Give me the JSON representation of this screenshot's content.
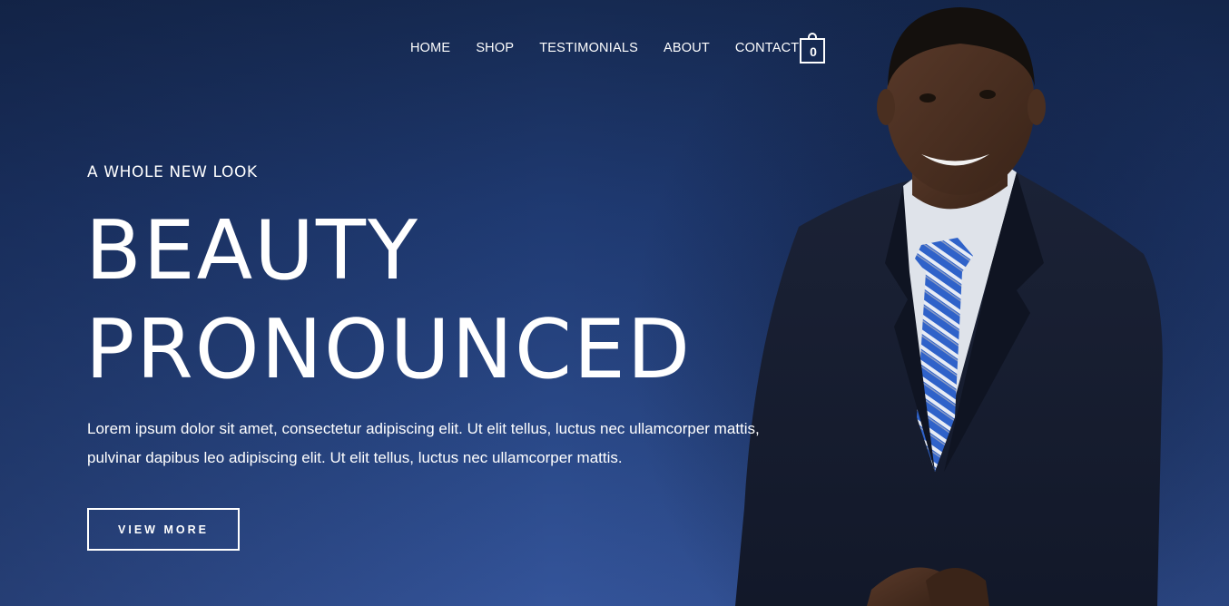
{
  "nav": {
    "items": [
      {
        "label": "HOME"
      },
      {
        "label": "SHOP"
      },
      {
        "label": "TESTIMONIALS"
      },
      {
        "label": "ABOUT"
      },
      {
        "label": "CONTACT"
      }
    ],
    "cart_count": "0"
  },
  "hero": {
    "eyebrow": "A WHOLE NEW LOOK",
    "headline_line1": "BEAUTY",
    "headline_line2": "PRONOUNCED",
    "description_line1": "Lorem ipsum dolor sit amet, consectetur adipiscing elit. Ut elit tellus, luctus nec ullamcorper mattis,",
    "description_line2": "pulvinar dapibus leo adipiscing elit. Ut elit tellus, luctus nec ullamcorper mattis.",
    "cta_label": "VIEW MORE"
  },
  "icons": {
    "cart": "shopping-bag-icon"
  },
  "colors": {
    "background_top": "#162a52",
    "background_bottom": "#34549a",
    "text": "#ffffff",
    "tie_blue": "#2f62c9"
  }
}
